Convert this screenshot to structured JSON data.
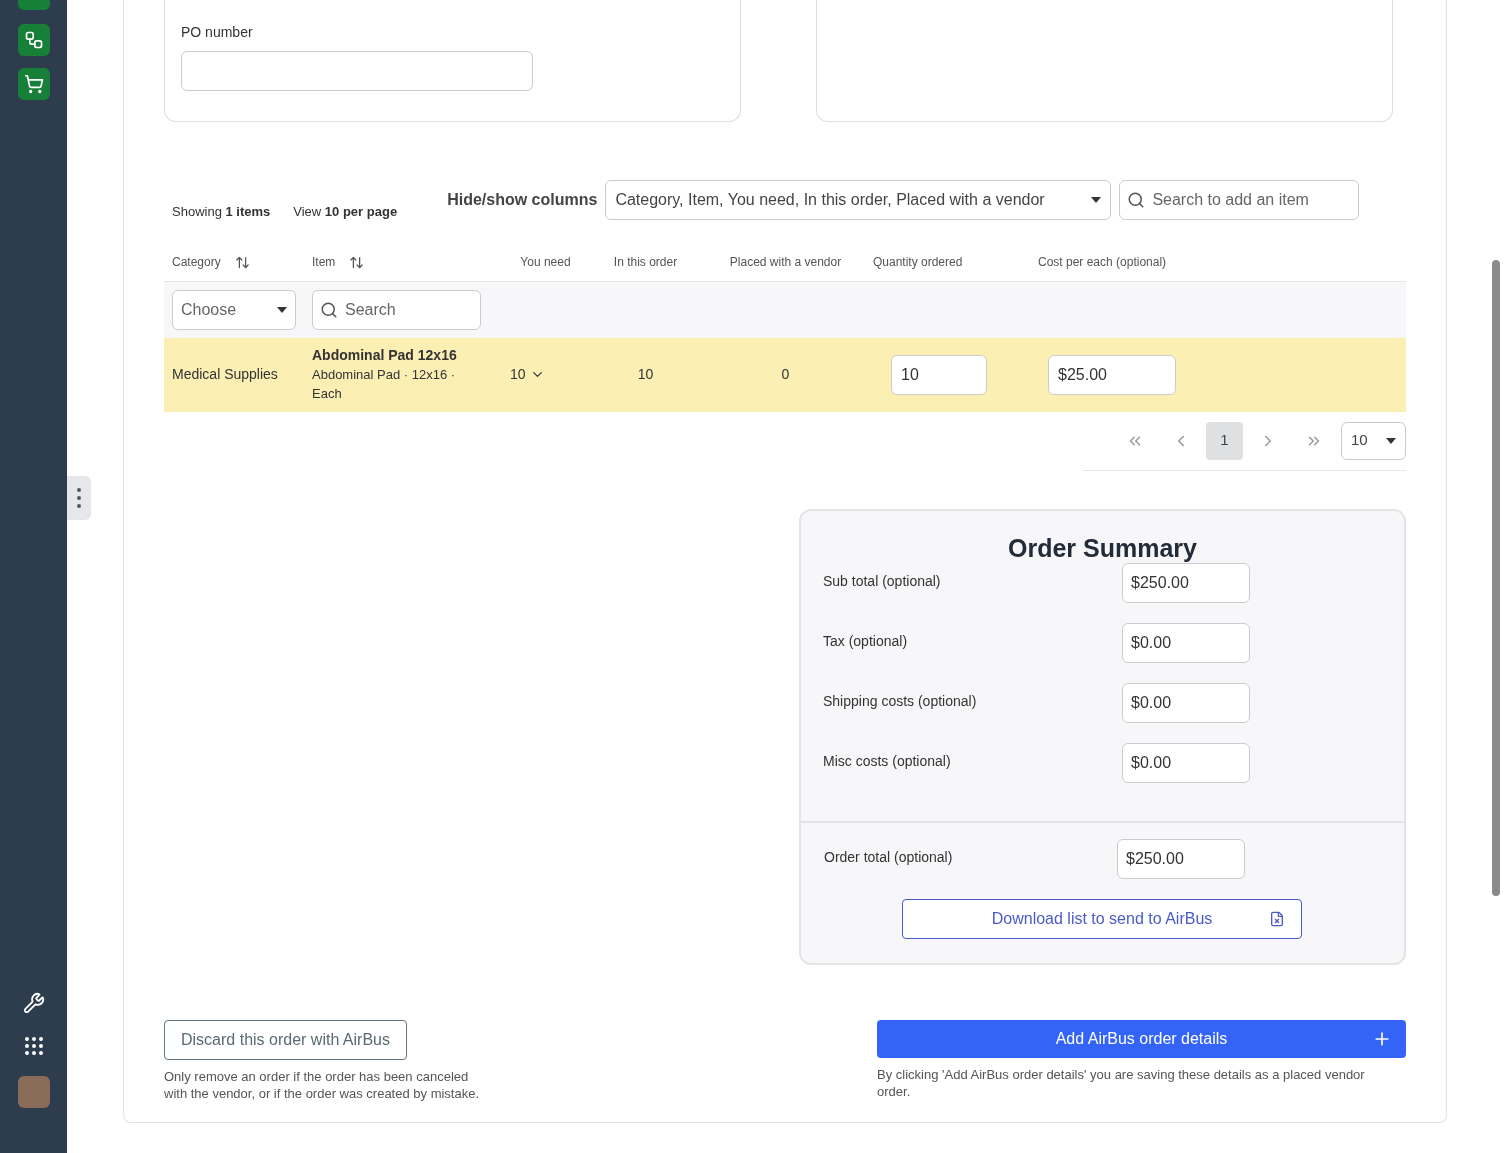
{
  "po_field": {
    "label": "PO number"
  },
  "toolbar": {
    "showing": "Showing **1 items**",
    "per_page": "View **10 per page**",
    "columns_label": "Hide/show columns",
    "columns_value": "Category, Item, You need, In this order, Placed with a vendor",
    "search_placeholder": "Search to add an item"
  },
  "table": {
    "columns": [
      {
        "label": "Category",
        "sortable": true
      },
      {
        "label": "Item",
        "sortable": true
      },
      {
        "label": "You need",
        "sortable": false
      },
      {
        "label": "In this order",
        "sortable": false
      },
      {
        "label": "Placed with a vendor",
        "sortable": false
      },
      {
        "label": "Quantity ordered",
        "sortable": false
      },
      {
        "label": "Cost per each (optional)",
        "sortable": false
      }
    ],
    "filters": {
      "category_placeholder": "Choose",
      "item_placeholder": "Search"
    },
    "rows": [
      {
        "category": "Medical Supplies",
        "item_name": "Abdominal Pad 12x16",
        "item_detail": "Abdominal Pad · 12x16 · Each",
        "you_need": "10",
        "in_this_order": "10",
        "placed": "0",
        "quantity": "10",
        "cost": "$25.00"
      }
    ]
  },
  "pagination": {
    "pages": [
      {
        "label": "1",
        "selected": true
      }
    ],
    "per_page": "10"
  },
  "summary": {
    "title": "Order Summary",
    "fields": [
      {
        "label": "Sub total (optional)",
        "value": "$250.00"
      },
      {
        "label": "Tax (optional)",
        "value": "$0.00"
      },
      {
        "label": "Shipping costs (optional)",
        "value": "$0.00"
      },
      {
        "label": "Misc costs (optional)",
        "value": "$0.00"
      }
    ],
    "total": {
      "label": "Order total (optional)",
      "value": "$250.00"
    },
    "download": "Download list to send to AirBus"
  },
  "discard": {
    "button": "Discard this order with AirBus",
    "note": "Only remove an order if the order has been canceled with the vendor, or if the order was created by mistake."
  },
  "submit": {
    "button": "Add AirBus order details",
    "note": "By clicking 'Add AirBus order details' you are saving these details as a placed vendor order."
  }
}
